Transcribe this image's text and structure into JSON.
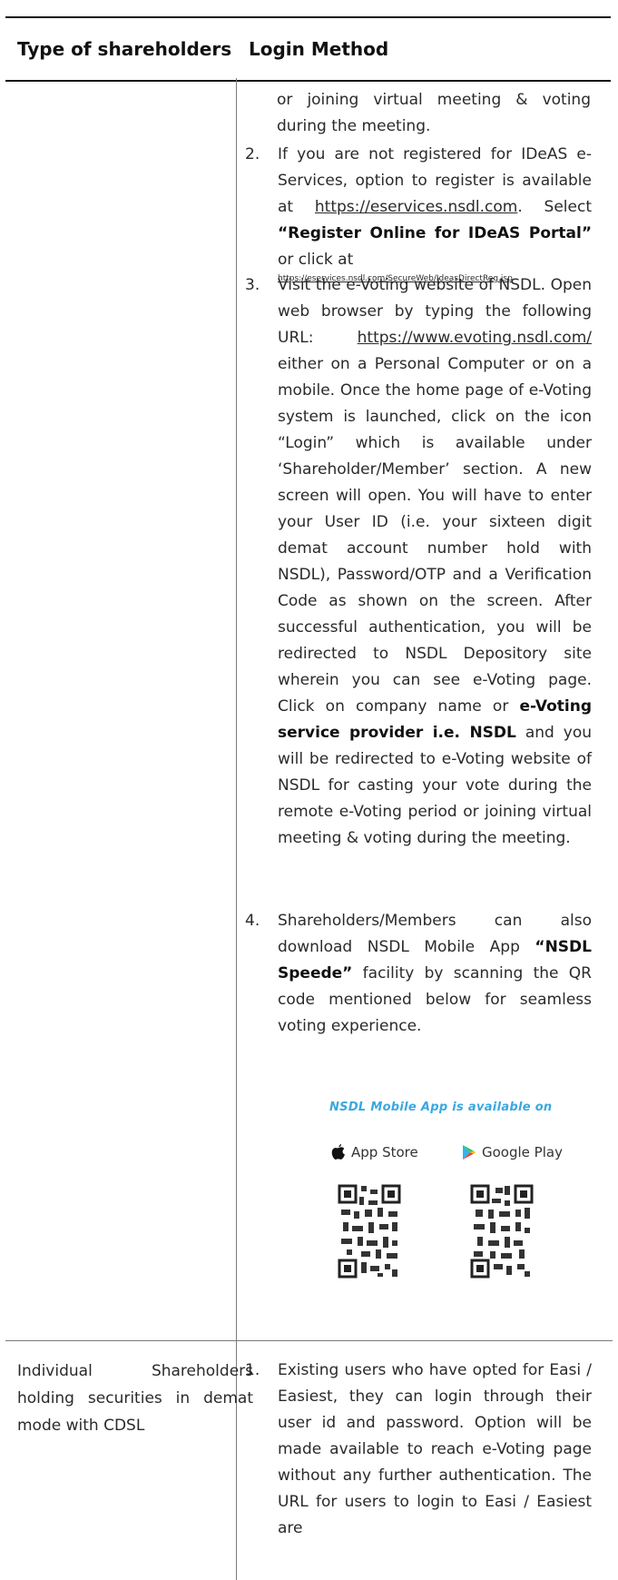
{
  "header": {
    "col1": "Type of shareholders",
    "col2": "Login Method"
  },
  "continued_text": "or joining virtual meeting & voting during the meeting.",
  "items": [
    {
      "num": "2.",
      "text_a": "If you are not registered for IDeAS e-Services, option to register is available at",
      "link_a": "https://eservices.nsdl.com",
      "text_b": ". Select",
      "bold": "“Register Online for IDeAS Portal”",
      "text_c": "or click at",
      "link_b": "https://eservices.nsdl.com/SecureWeb/IdeasDirectReg.jsp"
    },
    {
      "num": "3.",
      "text_a": "Visit the e-Voting website of NSDL. Open web browser by typing the following URL:",
      "link": "https://www.evoting.nsdl.com/",
      "text_b": "either on a Personal Computer or on a mobile. Once the home page of e-Voting system is launched, click on the icon “Login” which is available under ‘Shareholder/Member’ section. A new screen will open. You will have to enter your User ID (i.e. your sixteen digit demat account number hold with NSDL), Password/OTP and a Verification Code as shown on the screen. After successful authentication, you will be redirected to NSDL Depository site wherein you can see e-Voting page. Click on company name or",
      "bold": "e-Voting service provider i.e. NSDL",
      "text_c": "and you will be redirected to e-Voting website of NSDL for casting your vote during the remote e-Voting period or joining virtual meeting & voting during the meeting."
    },
    {
      "num": "4.",
      "text_a": "Shareholders/Members can also download NSDL Mobile App",
      "bold": "“NSDL Speede”",
      "text_b": "facility by scanning the QR code mentioned below for seamless voting experience."
    }
  ],
  "app_banner": {
    "title": "NSDL Mobile App is available on",
    "app_store": "App Store",
    "google_play": "Google Play"
  },
  "cdsl_row": {
    "type": "Individual Shareholders holding securities in demat mode with CDSL",
    "num": "1.",
    "text": "Existing users who have opted for Easi / Easiest, they can login through their user id and password. Option will be made available to reach e-Voting page without any further authentication. The URL for users to login to Easi / Easiest are"
  }
}
